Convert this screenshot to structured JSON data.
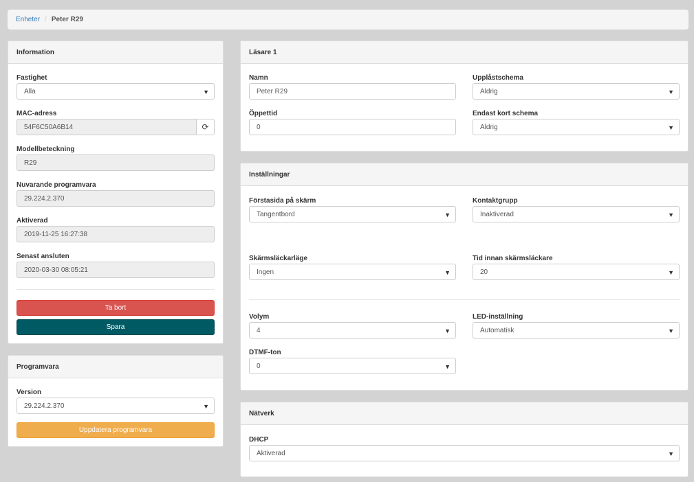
{
  "breadcrumb": {
    "link": "Enheter",
    "separator": "/",
    "current": "Peter R29"
  },
  "information": {
    "title": "Information",
    "fastighet_label": "Fastighet",
    "fastighet_value": "Alla",
    "mac_label": "MAC-adress",
    "mac_value": "54F6C50A6B14",
    "modell_label": "Modellbeteckning",
    "modell_value": "R29",
    "programvara_label": "Nuvarande programvara",
    "programvara_value": "29.224.2.370",
    "aktiverad_label": "Aktiverad",
    "aktiverad_value": "2019-11-25 16:27:38",
    "senast_label": "Senast ansluten",
    "senast_value": "2020-03-30 08:05:21",
    "delete_label": "Ta bort",
    "save_label": "Spara"
  },
  "programvara": {
    "title": "Programvara",
    "version_label": "Version",
    "version_value": "29.224.2.370",
    "update_label": "Uppdatera programvara"
  },
  "lasare": {
    "title": "Läsare 1",
    "namn_label": "Namn",
    "namn_value": "Peter R29",
    "upplast_label": "Upplåstschema",
    "upplast_value": "Aldrig",
    "oppettid_label": "Öppettid",
    "oppettid_value": "0",
    "endast_label": "Endast kort schema",
    "endast_value": "Aldrig"
  },
  "installningar": {
    "title": "Inställningar",
    "forstasida_label": "Förstasida på skärm",
    "forstasida_value": "Tangentbord",
    "kontakt_label": "Kontaktgrupp",
    "kontakt_value": "Inaktiverad",
    "skarm_label": "Skärmsläckarläge",
    "skarm_value": "Ingen",
    "tid_label": "Tid innan skärmsläckare",
    "tid_value": "20",
    "volym_label": "Volym",
    "volym_value": "4",
    "led_label": "LED-inställning",
    "led_value": "Automatisk",
    "dtmf_label": "DTMF-ton",
    "dtmf_value": "0"
  },
  "natverk": {
    "title": "Nätverk",
    "dhcp_label": "DHCP",
    "dhcp_value": "Aktiverad"
  },
  "icons": {
    "caret": "▼",
    "refresh": "⟳"
  }
}
